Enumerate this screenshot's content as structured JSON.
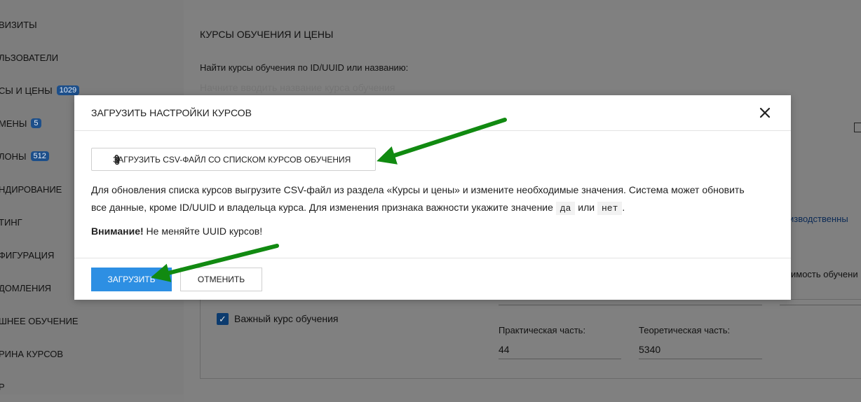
{
  "sidebar": {
    "items": [
      {
        "label": "ВИЗИТЫ",
        "badge": ""
      },
      {
        "label": "ЛЬЗОВАТЕЛИ",
        "badge": ""
      },
      {
        "label": "СЫ И ЦЕНЫ",
        "badge": "1029"
      },
      {
        "label": "МЕНЫ",
        "badge": "5"
      },
      {
        "label": "ЛОНЫ",
        "badge": "512"
      },
      {
        "label": "НДИРОВАНИЕ",
        "badge": ""
      },
      {
        "label": "ТИНГ",
        "badge": ""
      },
      {
        "label": "ФИГУРАЦИЯ",
        "badge": ""
      },
      {
        "label": "ДОМЛЕНИЯ",
        "badge": ""
      },
      {
        "label": "ШНЕЕ ОБУЧЕНИЕ",
        "badge": ""
      },
      {
        "label": "РИНА КУРСОВ",
        "badge": ""
      },
      {
        "label": "Р",
        "badge": ""
      }
    ]
  },
  "main": {
    "title": "КУРСЫ ОБУЧЕНИЯ И ЦЕНЫ",
    "find_label": "Найти курсы обучения по ID/UUID или названию:",
    "find_placeholder": "Начните вводить название курса обучения",
    "right_link_partial": "изводственны",
    "right_label_partial": "имость обучени",
    "important_label": "Важный курс обучения",
    "important_checked": true,
    "practical_label": "Практическая часть:",
    "practical_value": "44",
    "theory_label": "Теоретическая часть:",
    "theory_value": "5340"
  },
  "modal": {
    "title": "ЗАГРУЗИТЬ НАСТРОЙКИ КУРСОВ",
    "upload_button": "ЗАГРУЗИТЬ CSV-ФАЙЛ СО СПИСКОМ КУРСОВ ОБУЧЕНИЯ",
    "desc_line1": "Для обновления списка курсов выгрузите CSV-файл из раздела «Курсы и цены» и измените необходимые значения. Система может обновить",
    "desc_line2_start": "все данные, кроме ID/UUID и владельца курса. Для изменения признака важности укажите значение",
    "code_yes": "да",
    "or_word": "или",
    "code_no": "нет",
    "period": ".",
    "warning_bold": "Внимание!",
    "warning_text": " Не меняйте UUID курсов!",
    "submit_button": "ЗАГРУЗИТЬ",
    "cancel_button": "ОТМЕНИТЬ"
  },
  "colors": {
    "primary": "#2d8fe3",
    "arrow": "#118a11",
    "overlay_bg": "#7f7f7f"
  }
}
